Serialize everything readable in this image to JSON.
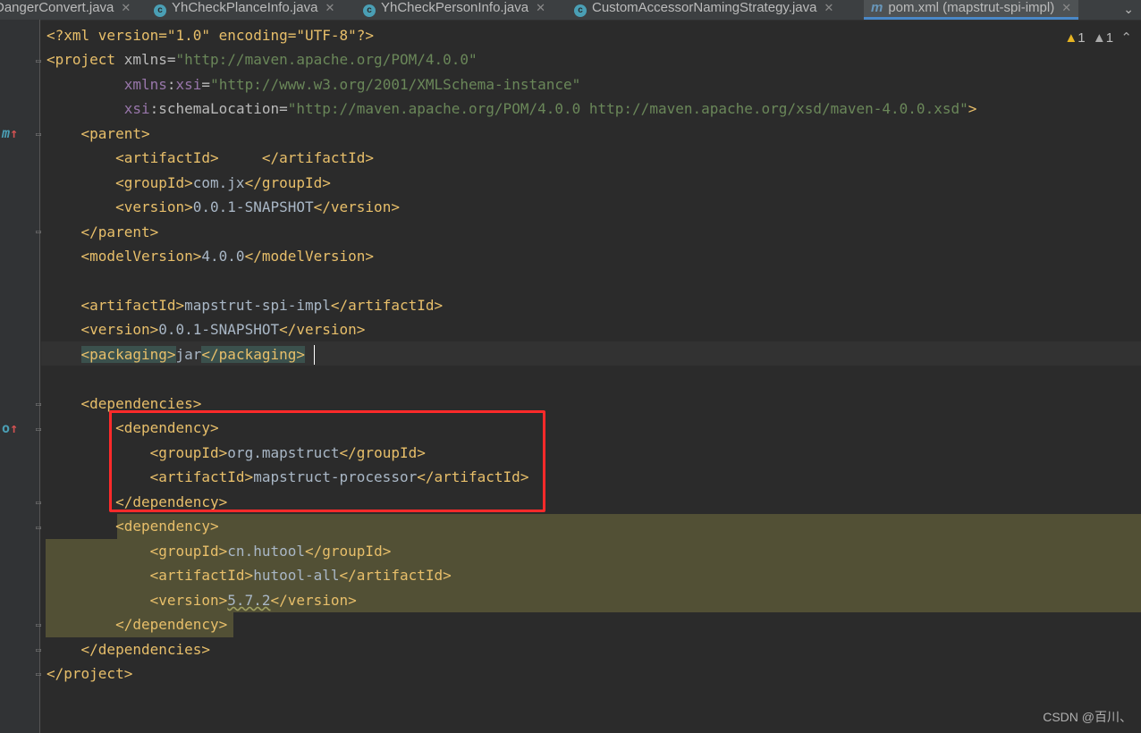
{
  "tabs": [
    {
      "label": "DangerConvert.java",
      "icon": "class-icon"
    },
    {
      "label": "YhCheckPlanceInfo.java",
      "icon": "class-icon"
    },
    {
      "label": "YhCheckPersonInfo.java",
      "icon": "class-icon"
    },
    {
      "label": "CustomAccessorNamingStrategy.java",
      "icon": "class-icon"
    },
    {
      "label": "pom.xml (mapstrut-spi-impl)",
      "icon": "maven-icon",
      "active": true
    }
  ],
  "inspections": {
    "warnings": "1",
    "weak_warnings": "1"
  },
  "code": {
    "l1_decl": "<?xml version=\"1.0\" encoding=\"UTF-8\"?>",
    "l2_xmlns_val": "\"http://maven.apache.org/POM/4.0.0\"",
    "l3_xsi_val": "\"http://www.w3.org/2001/XMLSchema-instance\"",
    "l4_schema_val": "\"http://maven.apache.org/POM/4.0.0 http://maven.apache.org/xsd/maven-4.0.0.xsd\"",
    "parent_artifactId": "",
    "parent_groupId": "com.jx",
    "parent_version": "0.0.1-SNAPSHOT",
    "modelVersion": "4.0.0",
    "artifactId": "mapstrut-spi-impl",
    "version": "0.0.1-SNAPSHOT",
    "packaging": "jar",
    "dep1_groupId": "org.mapstruct",
    "dep1_artifactId": "mapstruct-processor",
    "dep2_groupId": "cn.hutool",
    "dep2_artifactId": "hutool-all",
    "dep2_version": "5.7.2"
  },
  "watermark": "CSDN @百川、",
  "colors": {
    "tag": "#e8bf6a",
    "value": "#6a8759",
    "text": "#a9b7c6",
    "background": "#2b2b2b",
    "selection": "#525035",
    "annotation": "#ff2a2a"
  }
}
